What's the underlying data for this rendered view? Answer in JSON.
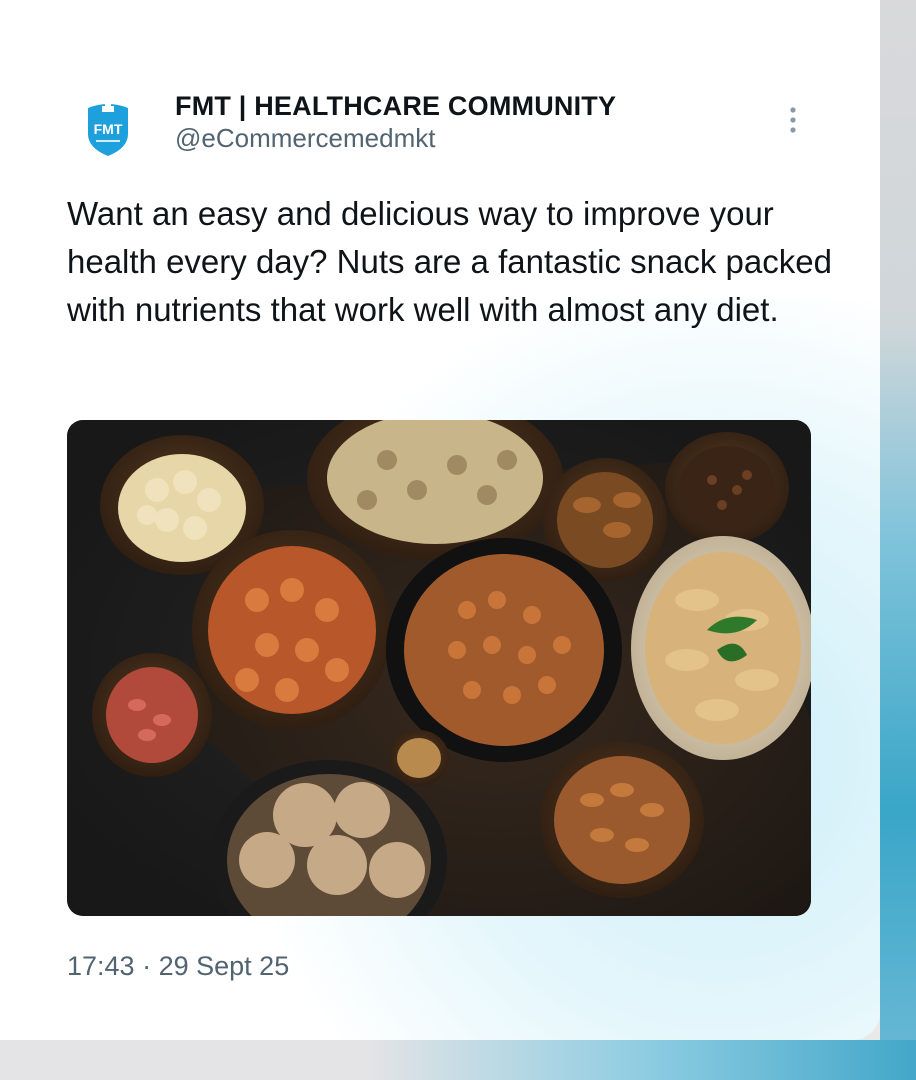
{
  "tweet": {
    "author": {
      "display_name": "FMT | HEALTHCARE COMMUNITY",
      "handle": "@eCommercemedmkt",
      "avatar_text": "FMT",
      "avatar_color": "#1ea0dc"
    },
    "text": "Want an easy and delicious way to improve your health every day? Nuts are a fantastic snack packed with nutrients that work well with almost any diet.",
    "media": {
      "subject": "bowls of assorted nuts on a dark wooden board"
    },
    "time": "17:43",
    "separator": "·",
    "date": "29 Sept 25"
  },
  "icons": {
    "more": "more-vertical-icon"
  },
  "colors": {
    "text_primary": "#0f1419",
    "text_secondary": "#536471"
  }
}
